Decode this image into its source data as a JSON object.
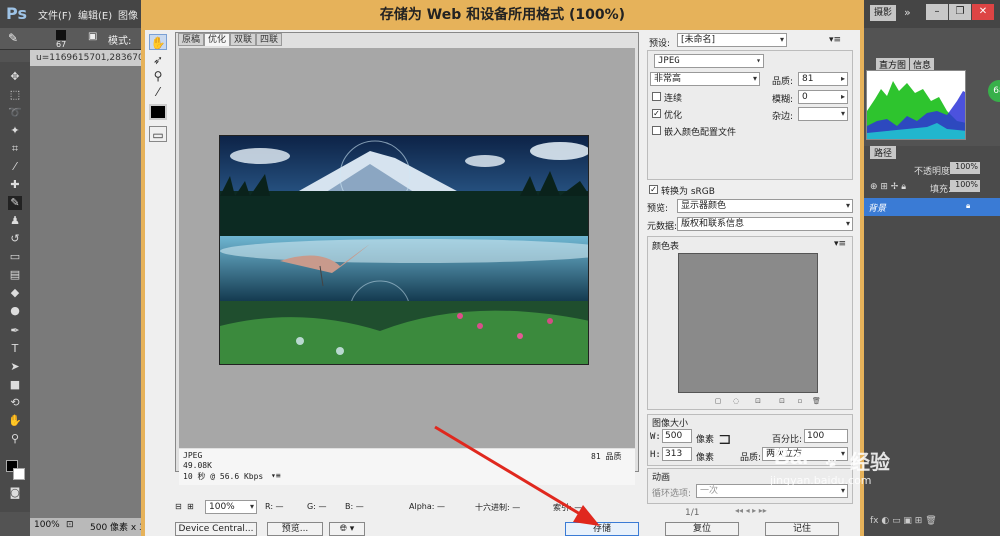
{
  "photoshop": {
    "logo": "Ps",
    "menus": [
      "文件(F)",
      "编辑(E)",
      "图像"
    ],
    "options": {
      "brush_size": "67",
      "mode_label": "模式:"
    },
    "doc_tab": "u=1169615701,2836702",
    "status": {
      "zoom": "100%",
      "dims": "500 像素 x 3"
    },
    "workspace_badge": "摄影",
    "histogram_tabs": [
      "直方图",
      "信息"
    ],
    "layers": {
      "tab": "路径",
      "opacity_label": "不透明度:",
      "opacity_value": "100%",
      "fill_label": "填充:",
      "fill_value": "100%",
      "layer_name": "背景"
    }
  },
  "dialog": {
    "title": "存储为 Web 和设备所用格式 (100%)",
    "tabs": [
      "原稿",
      "优化",
      "双联",
      "四联"
    ],
    "active_tab": "优化",
    "preview_info": {
      "format": "JPEG",
      "size": "49.08K",
      "time": "10 秒 @ 56.6 Kbps",
      "quality": "81 品质"
    },
    "bottom_bar": {
      "zoom": "100%",
      "r": "R: —",
      "g": "G: —",
      "b": "B: —",
      "alpha": "Alpha: —",
      "hex": "十六进制: —",
      "index": "索引: —"
    },
    "buttons": {
      "device_central": "Device Central...",
      "preview": "预览...",
      "save": "存储",
      "reset": "复位",
      "remember": "记住"
    },
    "settings": {
      "preset_label": "预设:",
      "preset_value": "[未命名]",
      "format_value": "JPEG",
      "quality_preset": "非常高",
      "quality_label": "品质:",
      "quality_value": "81",
      "progressive_label": "连续",
      "blur_label": "模糊:",
      "blur_value": "0",
      "optimized_label": "优化",
      "matte_label": "杂边:",
      "embed_profile_label": "嵌入颜色配置文件",
      "convert_srgb_label": "转换为 sRGB",
      "preview_label": "预览:",
      "preview_value": "显示器颜色",
      "metadata_label": "元数据:",
      "metadata_value": "版权和联系信息",
      "color_table_label": "颜色表",
      "image_size_label": "图像大小",
      "w_label": "W:",
      "w_value": "500",
      "h_label": "H:",
      "h_value": "313",
      "px_label": "像素",
      "percent_label": "百分比:",
      "percent_value": "100",
      "resample_label": "品质:",
      "resample_value": "两次立方",
      "animation_label": "动画",
      "loop_label": "循环选项:",
      "loop_value": "一次",
      "frame_counter": "1/1"
    }
  },
  "watermark": {
    "brand": "Bai",
    "brand2": "经验",
    "url": "jingyan.baidu.com"
  },
  "colors": {
    "dialog_frame": "#e6b25a",
    "ps_dark": "#535353",
    "arrow_red": "#e0281e",
    "selection_blue": "#3a7bd5"
  }
}
